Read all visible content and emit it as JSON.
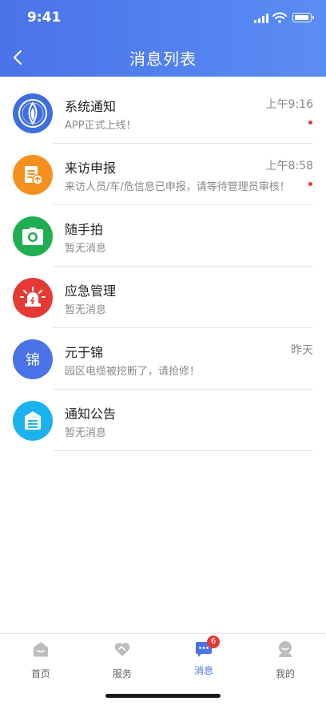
{
  "status_bar": {
    "time": "9:41"
  },
  "header": {
    "title": "消息列表",
    "back_icon": "chevron-left-icon"
  },
  "messages": [
    {
      "name": "系统通知",
      "preview": "APP正式上线！",
      "time": "上午9:16",
      "unread": true,
      "icon": "system-logo-icon",
      "color": "#3f6ee0"
    },
    {
      "name": "来访申报",
      "preview": "来访人员/车/危信息已申报，请等待管理员审核！",
      "time": "上午8:58",
      "unread": true,
      "icon": "document-upload-icon",
      "color": "#f5901f"
    },
    {
      "name": "随手拍",
      "preview": "暂无消息",
      "time": "",
      "unread": false,
      "icon": "camera-icon",
      "color": "#1fae52"
    },
    {
      "name": "应急管理",
      "preview": "暂无消息",
      "time": "",
      "unread": false,
      "icon": "alarm-light-icon",
      "color": "#e53935"
    },
    {
      "name": "元于锦",
      "avatar_text": "锦",
      "preview": "园区电缆被挖断了，请抢修！",
      "time": "昨天",
      "unread": false,
      "icon": "",
      "color": "#4a73e8"
    },
    {
      "name": "通知公告",
      "preview": "暂无消息",
      "time": "",
      "unread": false,
      "icon": "notice-board-icon",
      "color": "#1bb3ef"
    }
  ],
  "tabbar": {
    "tabs": [
      {
        "label": "首页",
        "icon": "home-icon",
        "active": false
      },
      {
        "label": "服务",
        "icon": "service-heart-icon",
        "active": false
      },
      {
        "label": "消息",
        "icon": "message-icon",
        "active": true,
        "badge": "6"
      },
      {
        "label": "我的",
        "icon": "profile-icon",
        "active": false
      }
    ]
  },
  "colors": {
    "accent": "#4a73e8",
    "unread_dot": "#e53935",
    "tab_inactive": "#bdbdbd"
  }
}
